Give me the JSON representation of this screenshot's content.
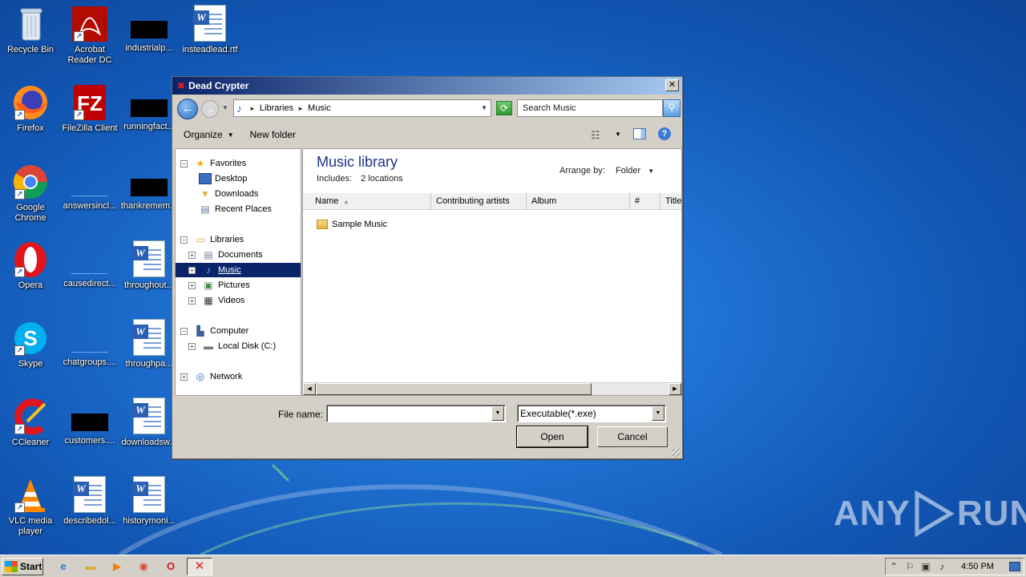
{
  "desktop": {
    "icons": [
      {
        "label": "Recycle Bin"
      },
      {
        "label": "Acrobat Reader DC"
      },
      {
        "label": "industrialp..."
      },
      {
        "label": "insteadlead.rtf"
      },
      {
        "label": "Firefox"
      },
      {
        "label": "FileZilla Client"
      },
      {
        "label": "runningfact..."
      },
      {
        "label": "Google Chrome"
      },
      {
        "label": "answersincl..."
      },
      {
        "label": "thankremem..."
      },
      {
        "label": "Opera"
      },
      {
        "label": "causedirect..."
      },
      {
        "label": "throughout..."
      },
      {
        "label": "Skype"
      },
      {
        "label": "chatgroups...."
      },
      {
        "label": "throughpa..."
      },
      {
        "label": "CCleaner"
      },
      {
        "label": "customers...."
      },
      {
        "label": "downloadsw..."
      },
      {
        "label": "VLC media player"
      },
      {
        "label": "describedol..."
      },
      {
        "label": "historymoni..."
      }
    ]
  },
  "dialog": {
    "title": "Dead Crypter",
    "close_label": "✕",
    "address": {
      "crumb1": "Libraries",
      "crumb2": "Music"
    },
    "search_placeholder": "Search Music",
    "toolbar": {
      "organize": "Organize",
      "new_folder": "New folder"
    },
    "nav": {
      "favorites": "Favorites",
      "desktop": "Desktop",
      "downloads": "Downloads",
      "recent": "Recent Places",
      "libraries": "Libraries",
      "documents": "Documents",
      "music": "Music",
      "pictures": "Pictures",
      "videos": "Videos",
      "computer": "Computer",
      "local_disk": "Local Disk (C:)",
      "network": "Network"
    },
    "library": {
      "title": "Music library",
      "includes_label": "Includes:",
      "includes_value": "2 locations",
      "arrange_label": "Arrange by:",
      "arrange_value": "Folder"
    },
    "columns": [
      "Name",
      "Contributing artists",
      "Album",
      "#",
      "Title"
    ],
    "files": [
      {
        "name": "Sample Music"
      }
    ],
    "file_name_label": "File name:",
    "file_name_value": "",
    "filter_value": "Executable(*.exe)",
    "open_label": "Open",
    "cancel_label": "Cancel"
  },
  "taskbar": {
    "start_label": "Start",
    "clock": "4:50 PM"
  },
  "watermark": {
    "left": "ANY",
    "right": "RUN"
  }
}
